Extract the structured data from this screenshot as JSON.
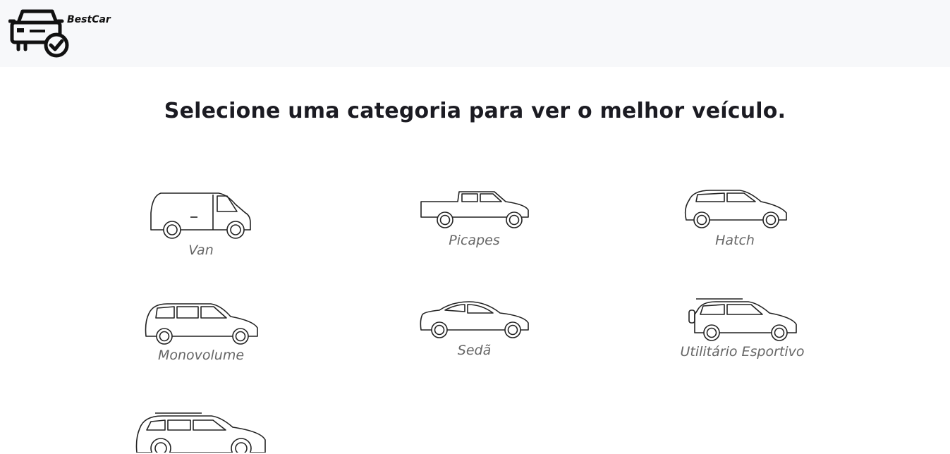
{
  "navbar": {
    "brand_name": "BestCar",
    "logo_icon": "car-check-icon"
  },
  "main": {
    "heading": "Selecione uma categoria para ver o melhor veículo.",
    "categories": [
      {
        "label": "Van",
        "icon": "van-icon"
      },
      {
        "label": "Picapes",
        "icon": "pickup-icon"
      },
      {
        "label": "Hatch",
        "icon": "hatch-icon"
      },
      {
        "label": "Monovolume",
        "icon": "minivan-icon"
      },
      {
        "label": "Sedã",
        "icon": "sedan-icon"
      },
      {
        "label": "Utilitário Esportivo",
        "icon": "suv-icon"
      },
      {
        "label": "",
        "icon": "station-wagon-icon"
      }
    ]
  }
}
